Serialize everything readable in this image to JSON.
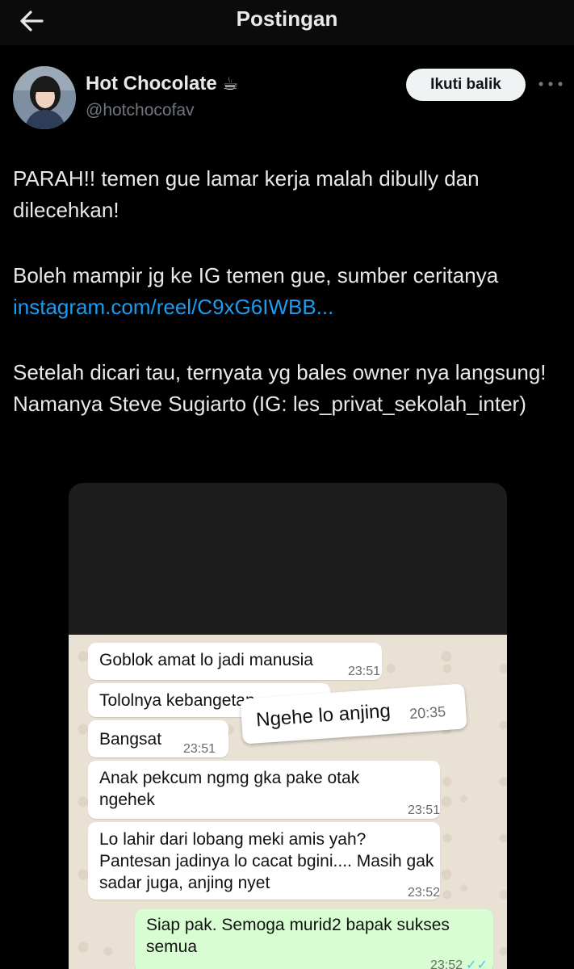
{
  "header": {
    "title": "Postingan"
  },
  "author": {
    "name": "Hot Chocolate",
    "emoji": "☕",
    "handle": "@hotchocofav",
    "follow_label": "Ikuti balik"
  },
  "post": {
    "paragraph1": "PARAH!! temen gue lamar kerja malah dibully dan dilecehkan!",
    "paragraph2_text": "Boleh mampir jg ke IG temen gue, sumber ceritanya",
    "paragraph2_link": "instagram.com/reel/C9xG6IWBB...",
    "paragraph3": "Setelah dicari tau, ternyata yg bales owner nya langsung! Namanya Steve Sugiarto (IG: les_privat_sekolah_inter)"
  },
  "chat": {
    "messages": [
      {
        "text": "Goblok amat lo jadi manusia",
        "time": "23:51"
      },
      {
        "text": "Tololnya kebangetan",
        "time": ""
      },
      {
        "text": "Ngehe lo anjing",
        "time": "20:35"
      },
      {
        "text": "Bangsat",
        "time": "23:51"
      },
      {
        "text": "Anak pekcum ngmg gka pake otak ngehek",
        "time": "23:51"
      },
      {
        "text": "Lo lahir dari lobang meki amis yah? Pantesan jadinya lo cacat bgini.... Masih gak sadar juga, anjing nyet",
        "time": "23:52"
      },
      {
        "text": "Siap pak.  Semoga murid2 bapak sukses semua",
        "time": "23:52",
        "ticks": "✓✓"
      }
    ]
  },
  "colors": {
    "background": "#000000",
    "text": "#e7e9ea",
    "secondary": "#71767b",
    "link": "#1d9bf0",
    "chat_bg": "#e9e1d4",
    "outgoing_bubble": "#d9fdd3"
  },
  "icons": {
    "back": "arrow-left-icon",
    "more": "more-horizontal-icon",
    "coffee": "coffee-emoji"
  }
}
